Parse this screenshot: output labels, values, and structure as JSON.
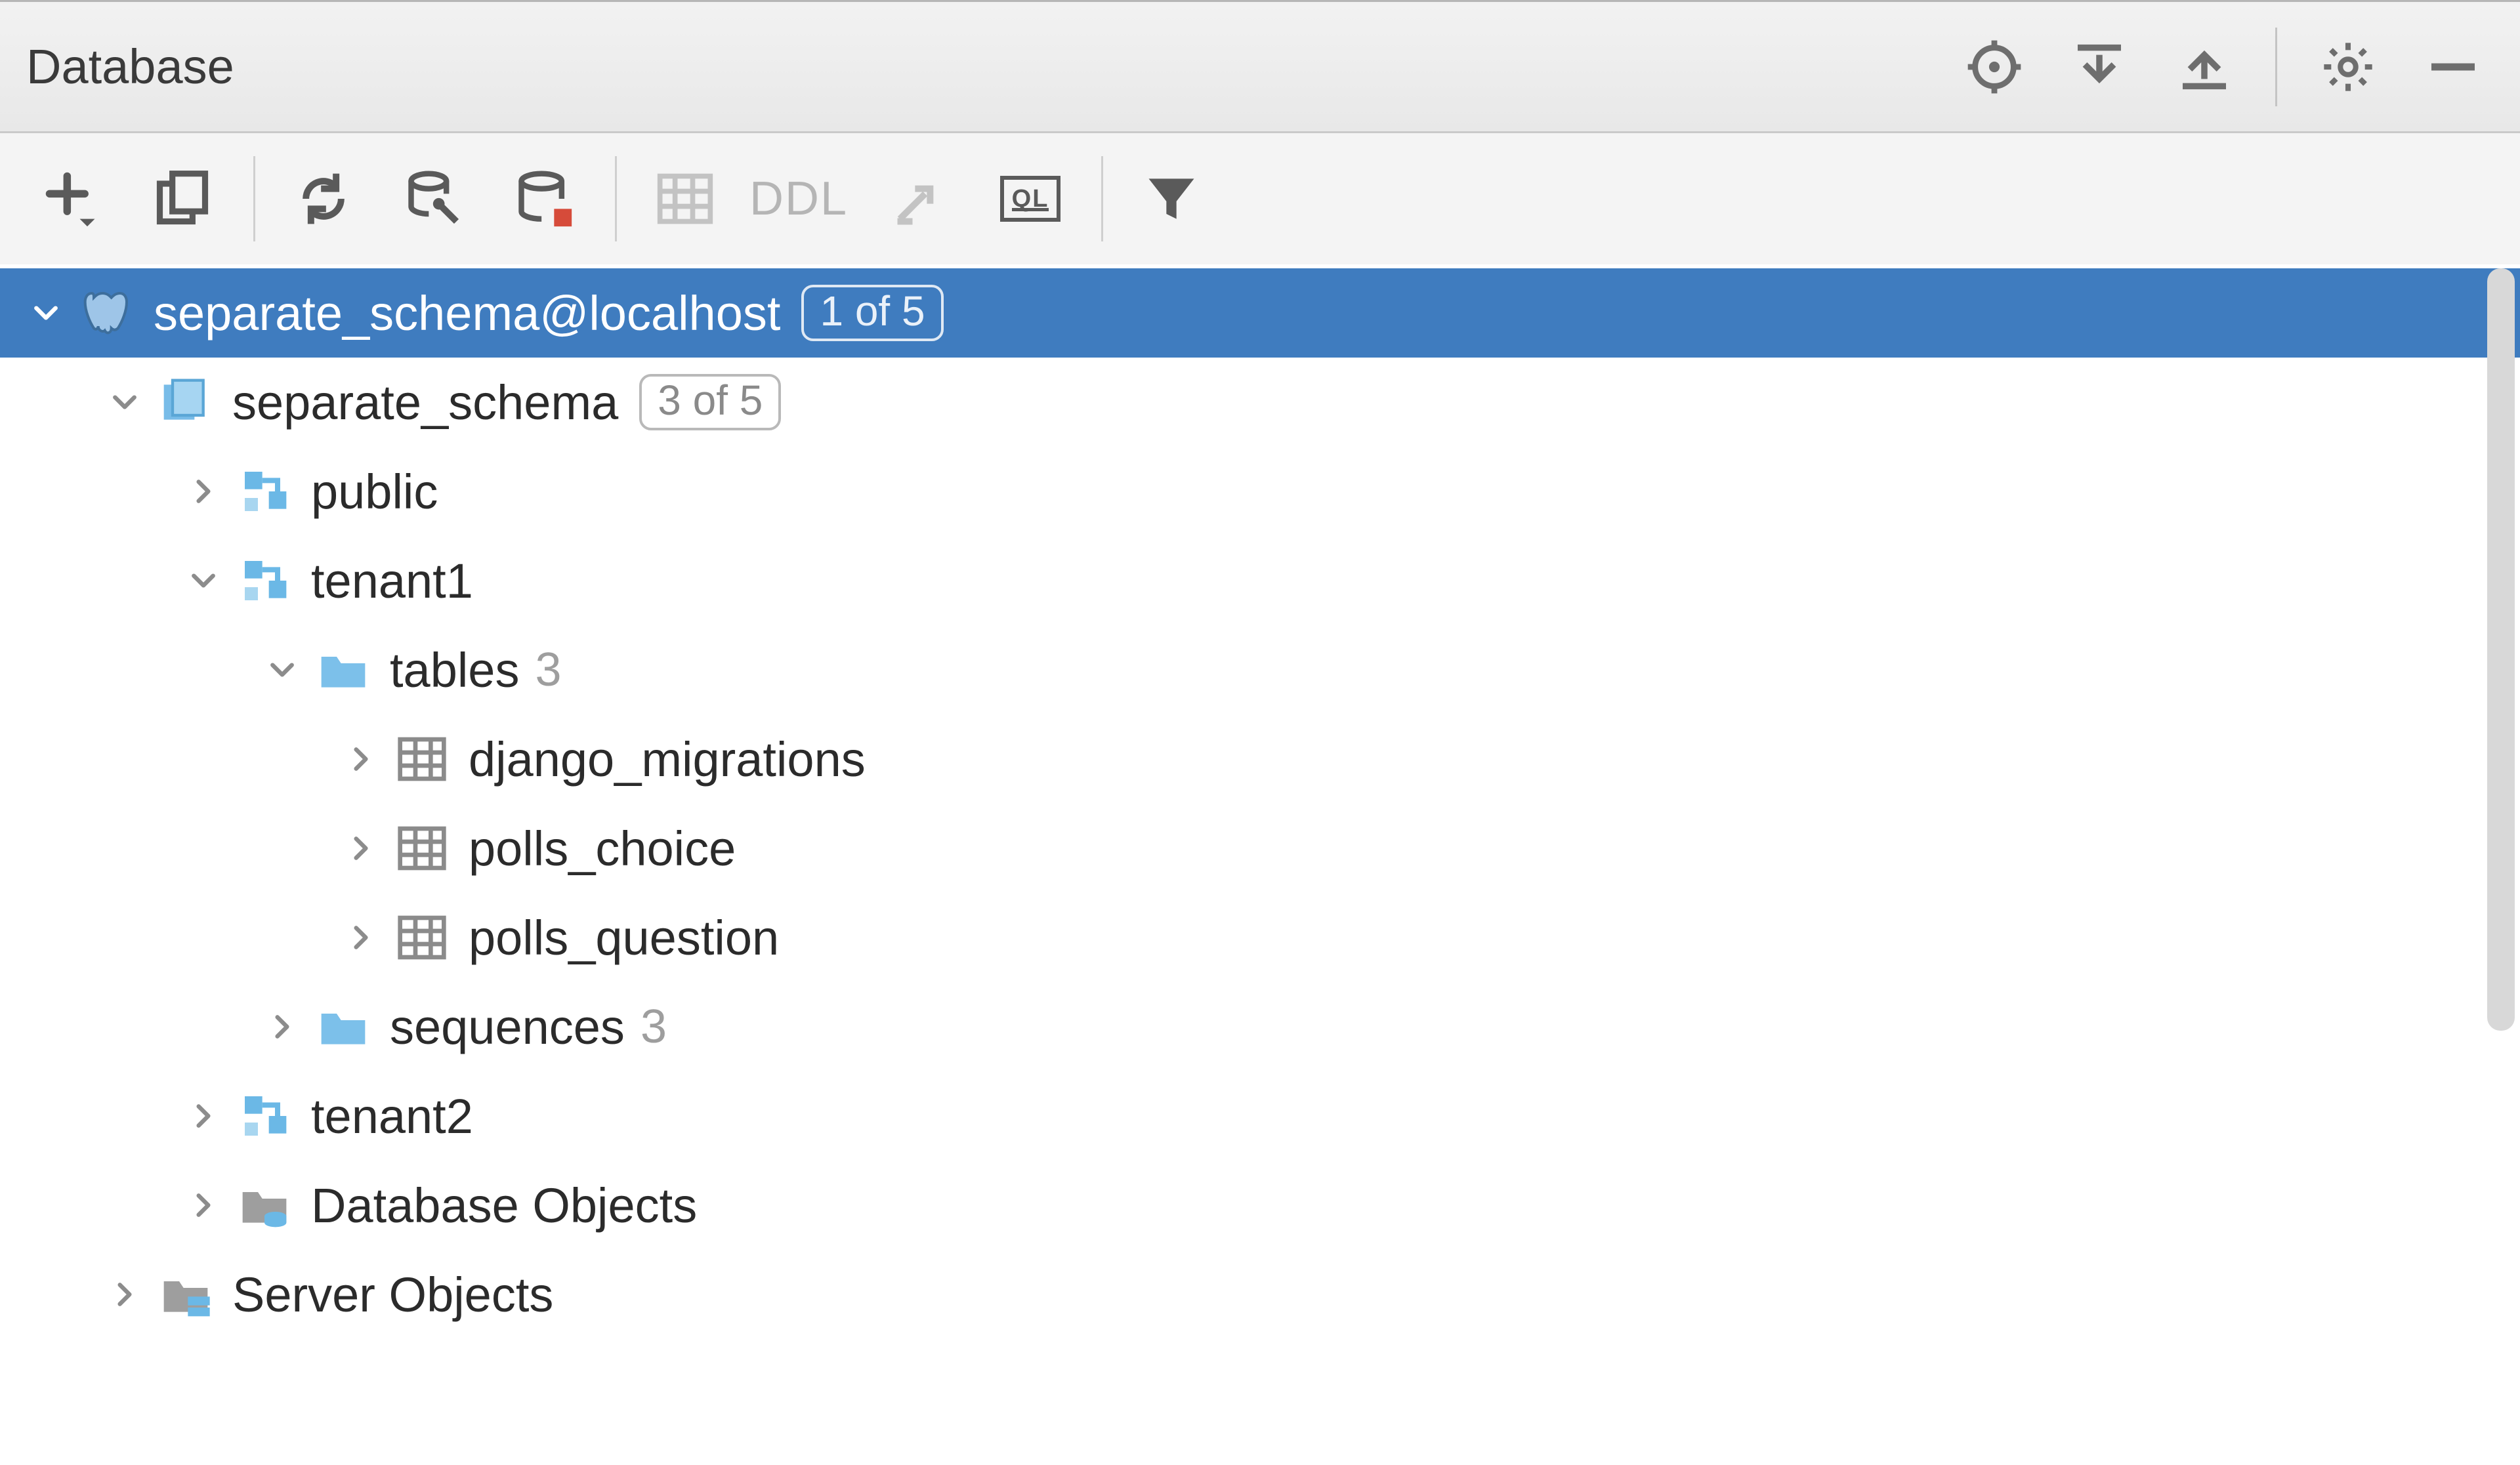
{
  "header": {
    "title": "Database"
  },
  "toolbar": {
    "ddl_label": "DDL",
    "ql_label": "QL"
  },
  "tree": {
    "datasource": {
      "label": "separate_schema@localhost",
      "badge": "1 of 5"
    },
    "database": {
      "label": "separate_schema",
      "badge": "3 of 5"
    },
    "schemas": {
      "public": {
        "label": "public"
      },
      "tenant1": {
        "label": "tenant1",
        "tables": {
          "label": "tables",
          "count": "3",
          "items": [
            {
              "label": "django_migrations"
            },
            {
              "label": "polls_choice"
            },
            {
              "label": "polls_question"
            }
          ]
        },
        "sequences": {
          "label": "sequences",
          "count": "3"
        }
      },
      "tenant2": {
        "label": "tenant2"
      }
    },
    "database_objects": {
      "label": "Database Objects"
    },
    "server_objects": {
      "label": "Server Objects"
    }
  }
}
